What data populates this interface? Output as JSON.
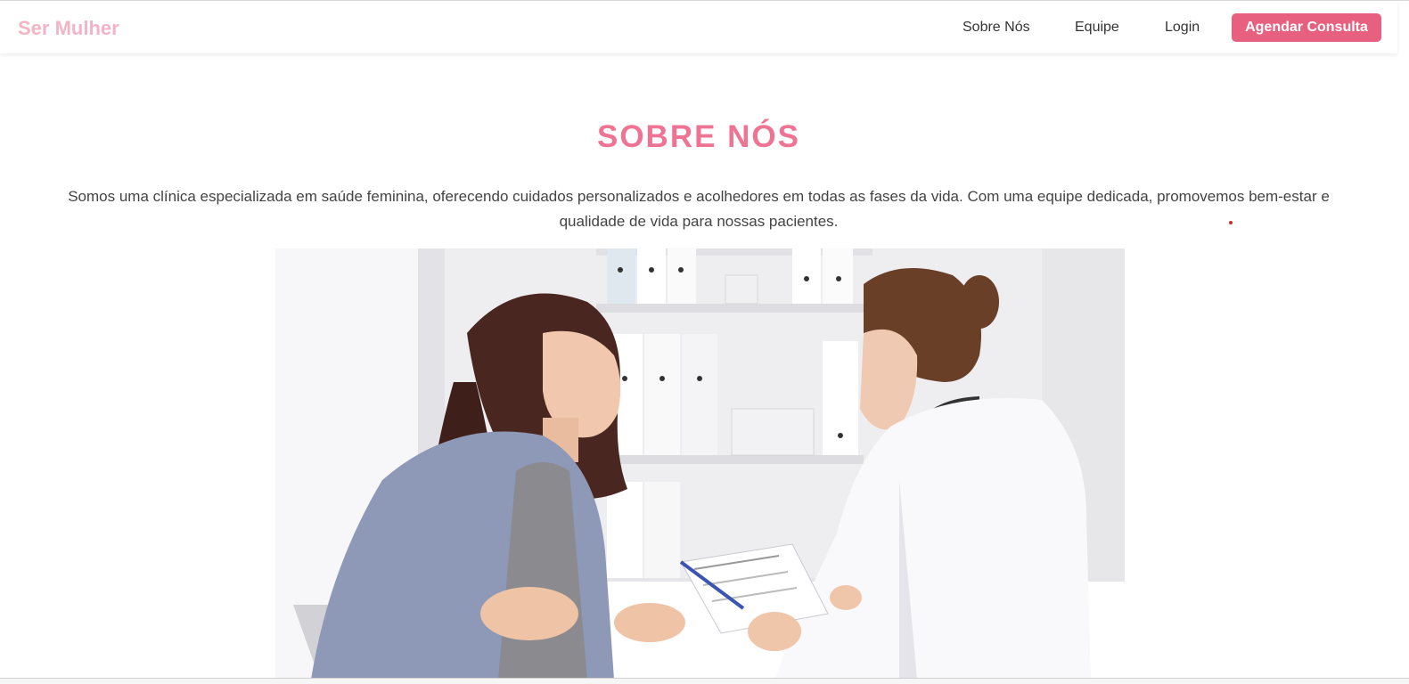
{
  "navbar": {
    "logo": "Ser Mulher",
    "links": [
      {
        "label": "Sobre Nós"
      },
      {
        "label": "Equipe"
      },
      {
        "label": "Login"
      }
    ],
    "cta_label": "Agendar Consulta"
  },
  "about": {
    "title": "SOBRE NÓS",
    "description": "Somos uma clínica especializada em saúde feminina, oferecendo cuidados personalizados e acolhedores em todas as fases da vida. Com uma equipe dedicada, promovemos bem-estar e qualidade de vida para nossas pacientes."
  },
  "colors": {
    "brand_pink": "#e8607f",
    "title_pink": "#ef7494",
    "logo_pink": "#f4b3c6",
    "text": "#444444"
  }
}
